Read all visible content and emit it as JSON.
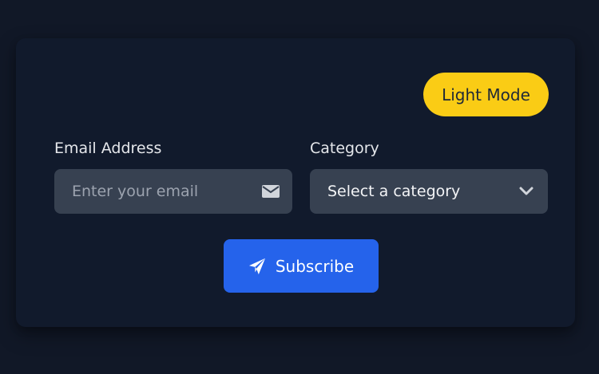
{
  "theme_toggle": {
    "label": "Light Mode"
  },
  "form": {
    "email": {
      "label": "Email Address",
      "placeholder": "Enter your email",
      "value": "",
      "icon": "envelope-icon"
    },
    "category": {
      "label": "Category",
      "selected": "Select a category",
      "icon": "chevron-down-icon"
    },
    "submit": {
      "label": "Subscribe",
      "icon": "paper-plane-icon"
    }
  },
  "colors": {
    "background": "#111827",
    "card": "#111a2c",
    "input": "#374151",
    "accent": "#2563eb",
    "toggle": "#facc15"
  }
}
